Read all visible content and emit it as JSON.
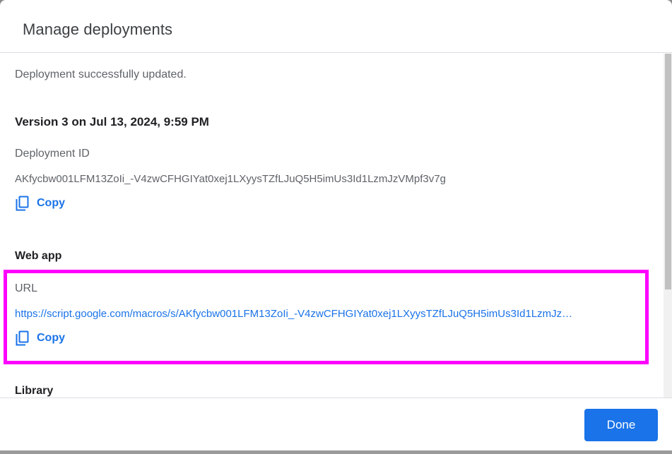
{
  "dialog": {
    "title": "Manage deployments",
    "status_message": "Deployment successfully updated.",
    "version_heading": "Version 3 on Jul 13, 2024, 9:59 PM",
    "deployment_id": {
      "label": "Deployment ID",
      "value": "AKfycbw001LFM13ZoIi_-V4zwCFHGIYat0xej1LXyysTZfLJuQ5H5imUs3Id1LzmJzVMpf3v7g",
      "copy_label": "Copy"
    },
    "web_app": {
      "heading": "Web app",
      "url_label": "URL",
      "url_value": "https://script.google.com/macros/s/AKfycbw001LFM13ZoIi_-V4zwCFHGIYat0xej1LXyysTZfLJuQ5H5imUs3Id1LzmJz…",
      "copy_label": "Copy"
    },
    "library_heading": "Library",
    "done_label": "Done"
  },
  "colors": {
    "accent": "#1a73e8",
    "highlight": "#ff00ff",
    "divider": "#dadce0"
  },
  "icons": {
    "copy": "copy-icon"
  }
}
